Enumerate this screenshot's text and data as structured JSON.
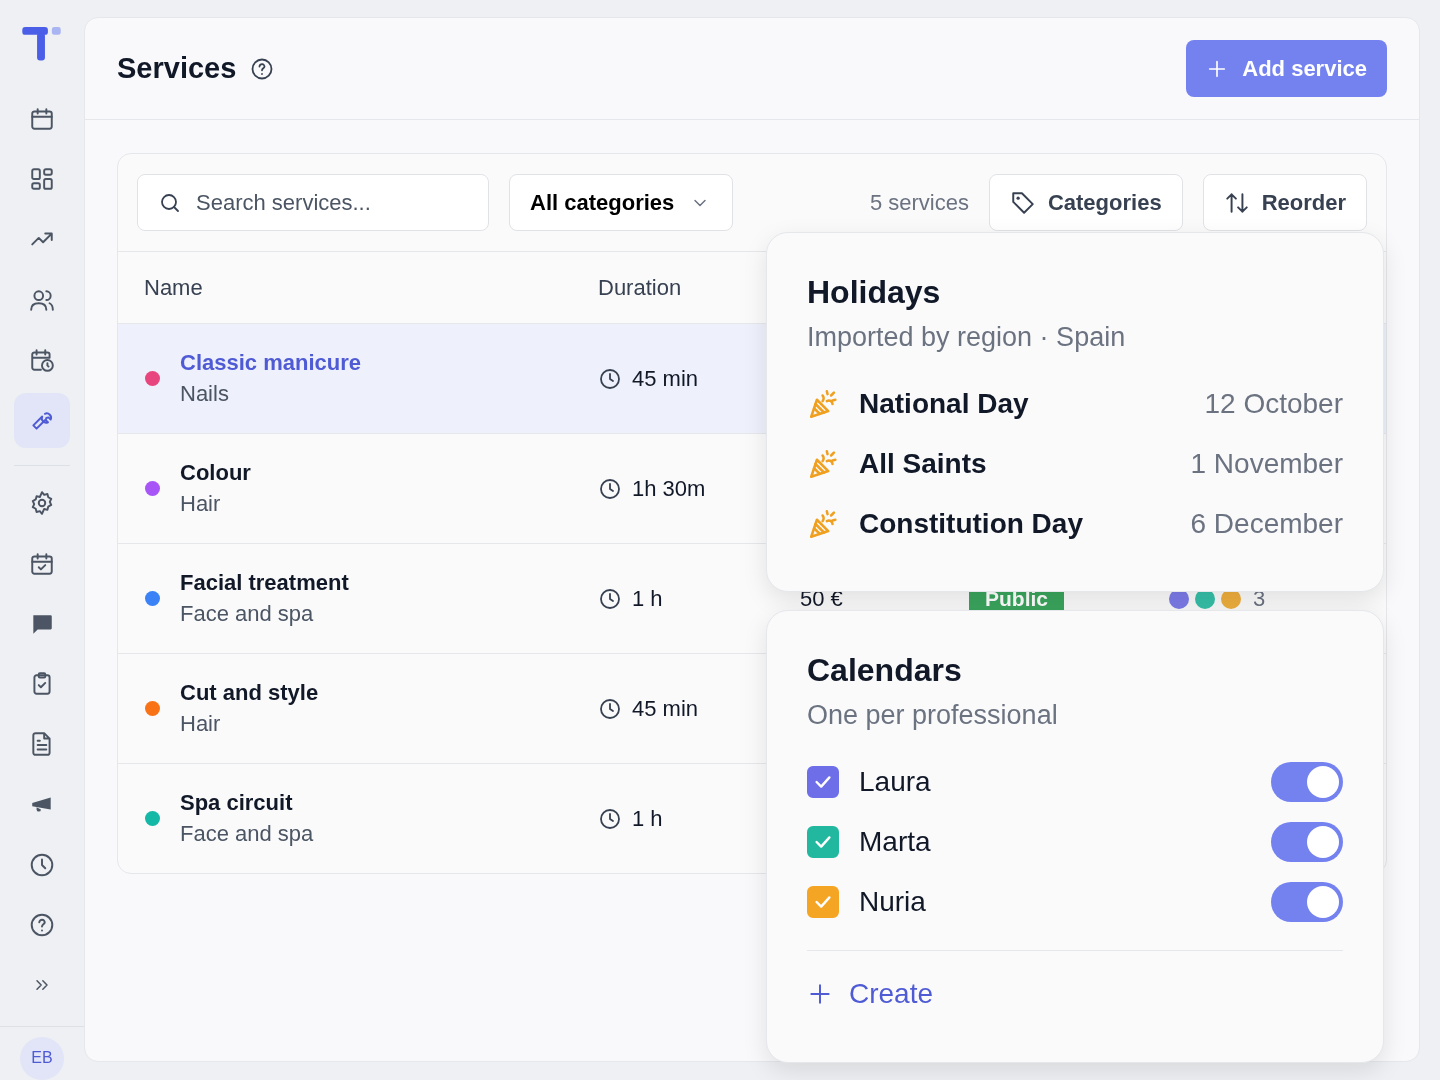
{
  "sidebar": {
    "primary_items": [
      {
        "kind": "calendar",
        "selected": false
      },
      {
        "kind": "dashboard",
        "selected": false
      },
      {
        "kind": "trend",
        "selected": false
      },
      {
        "kind": "users",
        "selected": false
      },
      {
        "kind": "calendar-clock",
        "selected": false
      },
      {
        "kind": "wrench",
        "selected": true
      }
    ],
    "secondary_items": [
      {
        "kind": "gear",
        "selected": false
      },
      {
        "kind": "calendar-check",
        "selected": false
      },
      {
        "kind": "chat",
        "selected": false
      },
      {
        "kind": "clipboard",
        "selected": false
      },
      {
        "kind": "document",
        "selected": false
      },
      {
        "kind": "megaphone",
        "selected": false
      },
      {
        "kind": "clock",
        "selected": false
      },
      {
        "kind": "help",
        "selected": false
      },
      {
        "kind": "expand",
        "selected": false
      }
    ],
    "avatar": "EB"
  },
  "header": {
    "title": "Services",
    "add_button": "Add service"
  },
  "toolbar": {
    "search_placeholder": "Search services...",
    "category_filter": "All categories",
    "count": "5 services",
    "buttons": [
      {
        "kind": "tag",
        "label": "Categories"
      },
      {
        "kind": "sort",
        "label": "Reorder"
      }
    ]
  },
  "table": {
    "columns": [
      "Name",
      "Duration"
    ],
    "rows": [
      {
        "name": "Classic manicure",
        "category": "Nails",
        "duration": "45 min",
        "color": "#e8457f",
        "selected": true
      },
      {
        "name": "Colour",
        "category": "Hair",
        "duration": "1h 30m",
        "color": "#a855f7",
        "selected": false
      },
      {
        "name": "Facial treatment",
        "category": "Face and spa",
        "duration": "1 h",
        "color": "#3b82f6",
        "selected": false,
        "price": "50 €",
        "visibility": "Public",
        "calendars": [
          {
            "color": "#7b7be8"
          },
          {
            "color": "#36bfa8"
          },
          {
            "color": "#eeae3e"
          }
        ],
        "calendar_count": "3"
      },
      {
        "name": "Cut and style",
        "category": "Hair",
        "duration": "45 min",
        "color": "#f97316",
        "selected": false
      },
      {
        "name": "Spa circuit",
        "category": "Face and spa",
        "duration": "1 h",
        "color": "#14b8a6",
        "selected": false
      }
    ]
  },
  "holidays_popover": {
    "title": "Holidays",
    "subtitle": "Imported by region · Spain",
    "items": [
      {
        "name": "National Day",
        "date": "12 October"
      },
      {
        "name": "All Saints",
        "date": "1 November"
      },
      {
        "name": "Constitution Day",
        "date": "6 December"
      }
    ]
  },
  "calendars_popover": {
    "title": "Calendars",
    "subtitle": "One per professional",
    "items": [
      {
        "name": "Laura",
        "color": "#6d6ee8",
        "checked": true,
        "on": true
      },
      {
        "name": "Marta",
        "color": "#22b8a0",
        "checked": true,
        "on": true
      },
      {
        "name": "Nuria",
        "color": "#f5a524",
        "checked": true,
        "on": true
      }
    ],
    "create_link": "Create"
  }
}
